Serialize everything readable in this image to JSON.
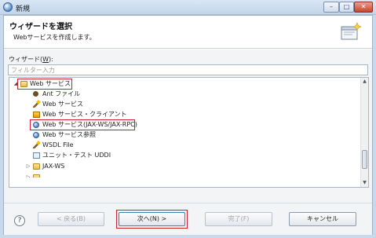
{
  "window": {
    "title": "新規",
    "minimize_glyph": "–",
    "maximize_glyph": "□",
    "close_glyph": "✕"
  },
  "banner": {
    "title": "ウィザードを選択",
    "description": "Webサービスを作成します。"
  },
  "filter": {
    "label_prefix": "ウィザード(",
    "label_mnemonic": "W",
    "label_suffix": "):",
    "placeholder": "フィルター入力"
  },
  "tree": {
    "items": [
      {
        "label": "Web サービス",
        "icon": "open-folder-icon",
        "expanded": true,
        "highlighted": true
      },
      {
        "label": "Ant ファイル",
        "icon": "ant-icon"
      },
      {
        "label": "Web サービス",
        "icon": "wizard-wand-icon"
      },
      {
        "label": "Web サービス・クライアント",
        "icon": "client-icon"
      },
      {
        "label": "Web サービス(JAX-WS/JAX-RPC)",
        "icon": "globe-icon",
        "highlighted": true
      },
      {
        "label": "Web サービス参照",
        "icon": "globe-icon"
      },
      {
        "label": "WSDL File",
        "icon": "wizard-wand-icon"
      },
      {
        "label": "ユニット・テスト UDDI",
        "icon": "doc-icon"
      },
      {
        "label": "JAX-WS",
        "icon": "folder-icon",
        "expanded": false
      }
    ]
  },
  "footer": {
    "help": "?",
    "back": "< 戻る(B)",
    "next": "次へ(N) >",
    "finish": "完了(F)",
    "cancel": "キャンセル"
  },
  "colors": {
    "highlight": "#d0202a",
    "titlebar": "#c3d5ea"
  }
}
